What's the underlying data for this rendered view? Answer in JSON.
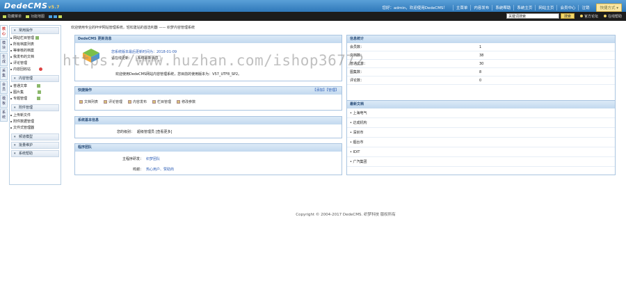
{
  "header": {
    "logo": "DedeCMS",
    "version": "v5.7",
    "welcome": "您好：admin，欢迎使用DedeCMS！",
    "nav": [
      "主菜单",
      "内容发布",
      "系统帮助",
      "系统主页",
      "网站主页",
      "会员中心",
      "注销"
    ],
    "quick_menu": "快捷方式"
  },
  "subbar": {
    "left_items": [
      "隐藏菜单",
      "功能地图"
    ],
    "search_placeholder": "关键词搜索",
    "search_btn": "搜索",
    "right_links": [
      "官方论坛",
      "在线帮助"
    ]
  },
  "vtabs": [
    "核心",
    "模块",
    "生成",
    "采集",
    "会员",
    "模板",
    "系统"
  ],
  "sidebar": {
    "sections": [
      {
        "title": "常用操作",
        "items": [
          "网站栏目管理",
          "所有档案列表",
          "等审核的档案",
          "我发布的文档",
          "评论管理",
          "内容回收站"
        ]
      },
      {
        "title": "内容管理",
        "items": [
          "普通文章",
          "图片集",
          "专题管理"
        ]
      },
      {
        "title": "附件管理",
        "items": [
          "上传新文件",
          "附件数据管理",
          "文件式管理器"
        ]
      },
      {
        "title": "频道模型",
        "items": []
      },
      {
        "title": "批量维护",
        "items": []
      },
      {
        "title": "系统帮助",
        "items": []
      }
    ]
  },
  "main": {
    "breadcrumb": "欢迎使用专业的PHP网站管理系统，轻松建站的首选利器 —— 织梦内容管理系统",
    "news": {
      "title": "DedeCMS 更新消息",
      "update_line": "您系统版本最后更新时间为：2018-01-09",
      "check_label": "请在线更新：",
      "check_btn": "系统最新消息",
      "version_line": "欢迎使用DedeCMS网站内容管理系统，您目前的使用版本为：V57_UTF8_SP2。"
    },
    "quick": {
      "title": "快捷操作",
      "links": "【添加】【管理】",
      "ops": [
        "文档列表",
        "评论管理",
        "内容发布",
        "栏目管理",
        "修改参数"
      ]
    },
    "sysinfo": {
      "title": "系统基本信息",
      "k": "您的级别：",
      "v": "超级管理员 [查看更多]"
    },
    "team": {
      "title": "程序团队",
      "rows": [
        {
          "k": "主程序研发：",
          "v": "织梦团队"
        },
        {
          "k": "鸣谢：",
          "v": "热心用户、赞助商"
        }
      ]
    },
    "stats": {
      "title": "信息统计",
      "rows": [
        {
          "k": "会员数：",
          "v": "1"
        },
        {
          "k": "文档数：",
          "v": "38"
        },
        {
          "k": "普通文章：",
          "v": "30"
        },
        {
          "k": "图集数：",
          "v": "8"
        },
        {
          "k": "评论数：",
          "v": "0"
        }
      ]
    },
    "docs": {
      "title": "最新文档",
      "items": [
        "上海电气",
        "达成机构",
        "深圳市",
        "烟台市",
        "IDIT",
        "广汽集团"
      ]
    }
  },
  "footer": "Copyright © 2004-2017 DedeCMS. 织梦科技 版权所有",
  "watermark": "https://www.huzhan.com/ishop36772"
}
